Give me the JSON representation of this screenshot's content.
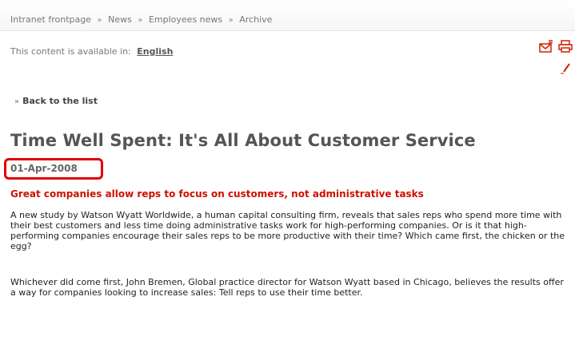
{
  "breadcrumb": {
    "items": [
      "Intranet frontpage",
      "News",
      "Employees news",
      "Archive"
    ],
    "separator": "»"
  },
  "language": {
    "prefix": "This content is available in:",
    "link": "English"
  },
  "tools": {
    "icons": [
      "email-icon",
      "print-icon",
      "edit-icon"
    ]
  },
  "back": {
    "arrow": "»",
    "label": "Back to the list"
  },
  "article": {
    "title": "Time Well Spent: It's All About Customer Service",
    "date": "01-Apr-2008",
    "lead": "Great companies allow reps to focus on customers, not administrative tasks",
    "paragraphs": [
      "A new study by Watson Wyatt Worldwide, a human capital consulting firm, reveals that sales reps who spend more time with their best customers and less time doing administrative tasks work for high-performing companies. Or is it that high-performing companies encourage their sales reps to be more productive with their time? Which came first, the chicken or the egg?",
      "Whichever did come first, John Bremen, Global practice director for Watson Wyatt based in Chicago, believes the results offer a way for companies looking to increase sales: Tell reps to use their time better."
    ]
  },
  "colors": {
    "highlight_box": "#e00000",
    "lead_text": "#cc1100",
    "icon_red": "#cc2200"
  }
}
